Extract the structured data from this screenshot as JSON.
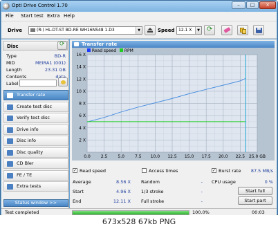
{
  "window": {
    "title": "Opti Drive Control 1.70",
    "controls": {
      "minimize": "–",
      "maximize": "□",
      "close": "×"
    }
  },
  "menu": [
    "File",
    "Start test",
    "Extra",
    "Help"
  ],
  "toolbar": {
    "drive_label": "Drive",
    "drive_value": "(R:)  HL-DT-ST BD-RE  WH16NS48 1.D3",
    "speed_label": "Speed",
    "speed_value": "12.1 X"
  },
  "disc": {
    "heading": "Disc",
    "rows": [
      {
        "label": "Type",
        "value": "BD-R"
      },
      {
        "label": "MID",
        "value": "MEIRA1 (001)"
      },
      {
        "label": "Length",
        "value": "23.31 GB"
      },
      {
        "label": "Contents",
        "value": "data"
      },
      {
        "label": "Label",
        "value": ""
      }
    ]
  },
  "nav": [
    {
      "label": "Transfer rate",
      "active": true,
      "icon": "transfer-rate-icon",
      "color": "#ffffff"
    },
    {
      "label": "Create test disc",
      "active": false,
      "icon": "create-disc-icon",
      "color": "#4a7fc1"
    },
    {
      "label": "Verify test disc",
      "active": false,
      "icon": "verify-disc-icon",
      "color": "#4a7fc1"
    },
    {
      "label": "Drive info",
      "active": false,
      "icon": "drive-info-icon",
      "color": "#4a7fc1"
    },
    {
      "label": "Disc info",
      "active": false,
      "icon": "disc-info-icon",
      "color": "#4a7fc1"
    },
    {
      "label": "Disc quality",
      "active": false,
      "icon": "disc-quality-icon",
      "color": "#4a7fc1"
    },
    {
      "label": "CD Bler",
      "active": false,
      "icon": "cd-bler-icon",
      "color": "#4a7fc1"
    },
    {
      "label": "FE / TE",
      "active": false,
      "icon": "fe-te-icon",
      "color": "#4a7fc1"
    },
    {
      "label": "Extra tests",
      "active": false,
      "icon": "extra-tests-icon",
      "color": "#4a7fc1"
    }
  ],
  "status_window_button": "Status window >>",
  "panel_title": "Transfer rate",
  "chart_data": {
    "type": "line",
    "legend": [
      "Read speed",
      "RPM"
    ],
    "legend_colors": [
      "#1e3cff",
      "#22cc22"
    ],
    "x_unit": "GB",
    "xlim": [
      0,
      25
    ],
    "ylim": [
      0,
      16
    ],
    "x_ticks": [
      0,
      2.5,
      5,
      7.5,
      10,
      12.5,
      15,
      17.5,
      20,
      22.5,
      25
    ],
    "x_tick_labels": [
      "0.0",
      "2.5",
      "5.0",
      "7.5",
      "10.0",
      "12.5",
      "15.0",
      "17.5",
      "20.0",
      "22.5",
      "25.0 GB"
    ],
    "y_ticks": [
      2,
      4,
      6,
      8,
      10,
      12,
      14,
      16
    ],
    "y_tick_labels": [
      "2 X",
      "4 X",
      "6 X",
      "8 X",
      "10 X",
      "12 X",
      "14 X",
      "16 X"
    ],
    "grid": true,
    "series": [
      {
        "name": "Read speed",
        "color": "#4a8fe0",
        "x": [
          0,
          2.5,
          5,
          7.5,
          10,
          12.5,
          15,
          17.5,
          20,
          22.5,
          23.3
        ],
        "y": [
          4.96,
          5.7,
          6.6,
          7.4,
          8.1,
          8.8,
          9.6,
          10.3,
          11.0,
          11.7,
          12.11
        ]
      },
      {
        "name": "RPM",
        "color": "#22cc22",
        "x": [
          0,
          23.3
        ],
        "y": [
          5.0,
          5.0
        ]
      }
    ],
    "marker_x": 23.3
  },
  "options": {
    "read_speed": {
      "label": "Read speed",
      "checked": true
    },
    "access_times": {
      "label": "Access times",
      "checked": false
    },
    "burst_rate": {
      "label": "Burst rate",
      "checked": true,
      "value": "87.5 MB/s"
    }
  },
  "stats": {
    "average": {
      "label": "Average",
      "value": "8.56 X"
    },
    "start": {
      "label": "Start",
      "value": "4.96 X"
    },
    "end": {
      "label": "End",
      "value": "12.11 X"
    },
    "random": {
      "label": "Random",
      "value": "-"
    },
    "stroke13": {
      "label": "1/3 stroke",
      "value": "-"
    },
    "full_stroke": {
      "label": "Full stroke",
      "value": "-"
    },
    "cpu_usage": {
      "label": "CPU usage",
      "value": "0 %"
    }
  },
  "buttons": {
    "start_full": "Start full",
    "start_part": "Start part"
  },
  "status": {
    "text": "Test completed",
    "progress_label": "100.0%",
    "progress": 1.0,
    "time": "00:03"
  },
  "caption": "673x528  67kb  PNG"
}
